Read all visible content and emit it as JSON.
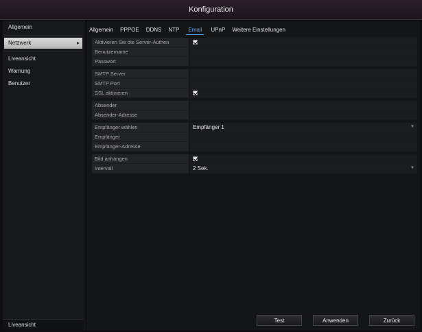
{
  "window": {
    "title": "Konfiguration"
  },
  "sidebar": {
    "items": [
      {
        "label": "Allgemein"
      },
      {
        "label": "Netzwerk"
      },
      {
        "label": "Liveansicht"
      },
      {
        "label": "Warnung"
      },
      {
        "label": "Benutzer"
      }
    ],
    "active_index": 1,
    "bottom_label": "Liveansicht"
  },
  "tabs": [
    {
      "label": "Allgemein"
    },
    {
      "label": "PPPOE"
    },
    {
      "label": "DDNS"
    },
    {
      "label": "NTP"
    },
    {
      "label": "Email"
    },
    {
      "label": "UPnP"
    },
    {
      "label": "Weitere Einstellungen"
    }
  ],
  "active_tab": "Email",
  "form": {
    "auth_label": "Aktivieren Sie die Server-Authen",
    "auth_checked": true,
    "user_label": "Benutzername",
    "user_value": "",
    "password_label": "Passwort",
    "password_value": "",
    "smtp_server_label": "SMTP Server",
    "smtp_server_value": "",
    "smtp_port_label": "SMTP Port",
    "smtp_port_value": "",
    "ssl_label": "SSL aktivieren",
    "ssl_checked": true,
    "sender_label": "Absender",
    "sender_value": "",
    "sender_address_label": "Absender-Adresse",
    "sender_address_value": "",
    "select_recipient_label": "Empfänger wählen",
    "select_recipient_value": "Empfänger 1",
    "recipient_label": "Empfänger",
    "recipient_value": "",
    "recipient_address_label": "Empfänger-Adresse",
    "recipient_address_value": "",
    "attach_image_label": "Bild anhängen",
    "attach_image_checked": true,
    "interval_label": "Intervall",
    "interval_value": "2 Sek."
  },
  "buttons": {
    "test": "Test",
    "apply": "Anwenden",
    "back": "Zurück"
  }
}
